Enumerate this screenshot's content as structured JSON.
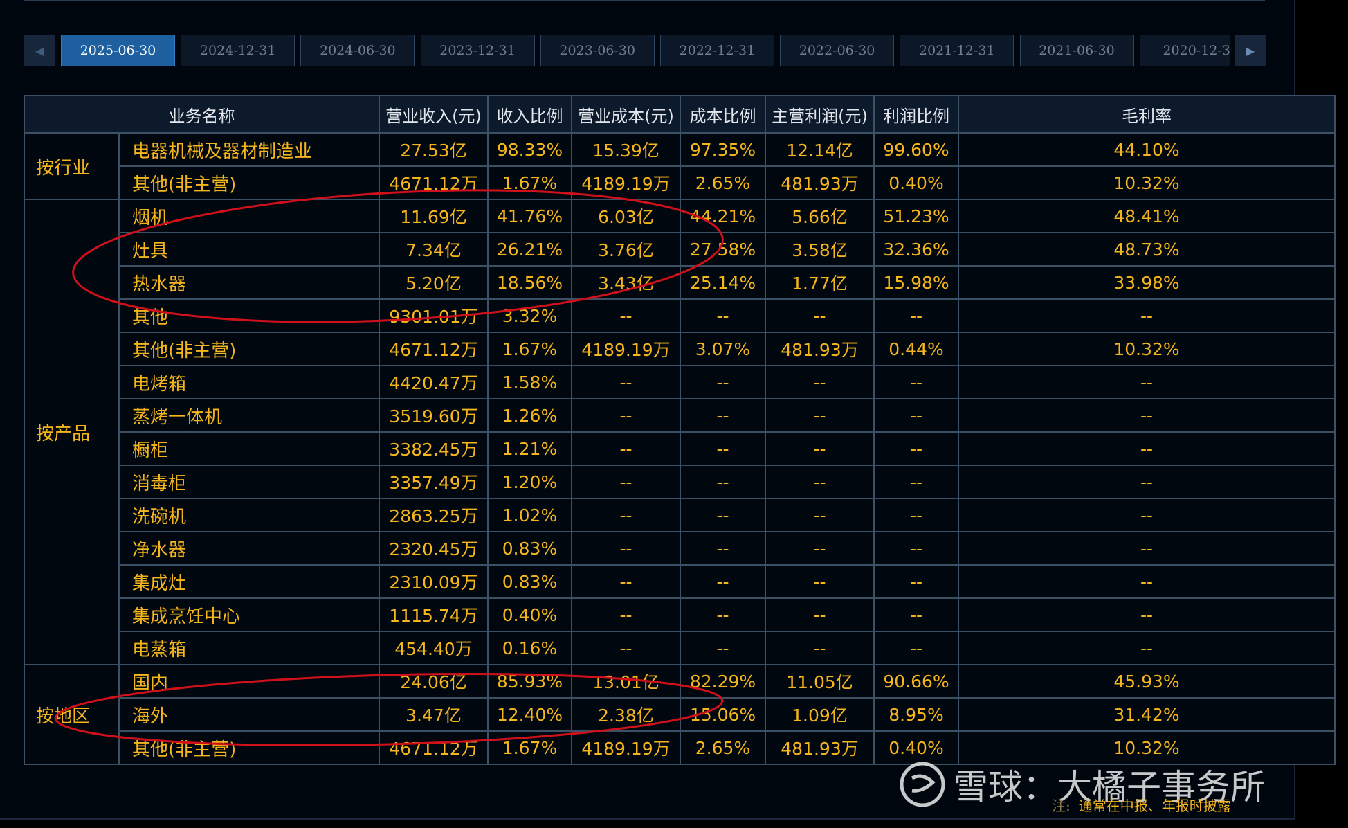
{
  "tabs": [
    "2025-06-30",
    "2024-12-31",
    "2024-06-30",
    "2023-12-31",
    "2023-06-30",
    "2022-12-31",
    "2022-06-30",
    "2021-12-31",
    "2021-06-30",
    "2020-12-3"
  ],
  "active_tab": 0,
  "table": {
    "headers": [
      "业务名称",
      "营业收入(元)",
      "收入比例",
      "营业成本(元)",
      "成本比例",
      "主营利润(元)",
      "利润比例",
      "毛利率"
    ],
    "groups": [
      {
        "label": "按行业",
        "rows": [
          [
            "电器机械及器材制造业",
            "27.53亿",
            "98.33%",
            "15.39亿",
            "97.35%",
            "12.14亿",
            "99.60%",
            "44.10%"
          ],
          [
            "其他(非主营)",
            "4671.12万",
            "1.67%",
            "4189.19万",
            "2.65%",
            "481.93万",
            "0.40%",
            "10.32%"
          ]
        ]
      },
      {
        "label": "按产品",
        "rows": [
          [
            "烟机",
            "11.69亿",
            "41.76%",
            "6.03亿",
            "44.21%",
            "5.66亿",
            "51.23%",
            "48.41%"
          ],
          [
            "灶具",
            "7.34亿",
            "26.21%",
            "3.76亿",
            "27.58%",
            "3.58亿",
            "32.36%",
            "48.73%"
          ],
          [
            "热水器",
            "5.20亿",
            "18.56%",
            "3.43亿",
            "25.14%",
            "1.77亿",
            "15.98%",
            "33.98%"
          ],
          [
            "其他",
            "9301.01万",
            "3.32%",
            "--",
            "--",
            "--",
            "--",
            "--"
          ],
          [
            "其他(非主营)",
            "4671.12万",
            "1.67%",
            "4189.19万",
            "3.07%",
            "481.93万",
            "0.44%",
            "10.32%"
          ],
          [
            "电烤箱",
            "4420.47万",
            "1.58%",
            "--",
            "--",
            "--",
            "--",
            "--"
          ],
          [
            "蒸烤一体机",
            "3519.60万",
            "1.26%",
            "--",
            "--",
            "--",
            "--",
            "--"
          ],
          [
            "橱柜",
            "3382.45万",
            "1.21%",
            "--",
            "--",
            "--",
            "--",
            "--"
          ],
          [
            "消毒柜",
            "3357.49万",
            "1.20%",
            "--",
            "--",
            "--",
            "--",
            "--"
          ],
          [
            "洗碗机",
            "2863.25万",
            "1.02%",
            "--",
            "--",
            "--",
            "--",
            "--"
          ],
          [
            "净水器",
            "2320.45万",
            "0.83%",
            "--",
            "--",
            "--",
            "--",
            "--"
          ],
          [
            "集成灶",
            "2310.09万",
            "0.83%",
            "--",
            "--",
            "--",
            "--",
            "--"
          ],
          [
            "集成烹饪中心",
            "1115.74万",
            "0.40%",
            "--",
            "--",
            "--",
            "--",
            "--"
          ],
          [
            "电蒸箱",
            "454.40万",
            "0.16%",
            "--",
            "--",
            "--",
            "--",
            "--"
          ]
        ]
      },
      {
        "label": "按地区",
        "rows": [
          [
            "国内",
            "24.06亿",
            "85.93%",
            "13.01亿",
            "82.29%",
            "11.05亿",
            "90.66%",
            "45.93%"
          ],
          [
            "海外",
            "3.47亿",
            "12.40%",
            "2.38亿",
            "15.06%",
            "1.09亿",
            "8.95%",
            "31.42%"
          ],
          [
            "其他(非主营)",
            "4671.12万",
            "1.67%",
            "4189.19万",
            "2.65%",
            "481.93万",
            "0.40%",
            "10.32%"
          ]
        ]
      }
    ]
  },
  "watermark": {
    "logo_icon": "xueqiu-logo-icon",
    "text": "雪球：大橘子事务所"
  },
  "note": {
    "label": "注:",
    "text": "通常在中报、年报时披露"
  },
  "colors": {
    "value": "#f5b51c",
    "header_text": "#e2e7ee",
    "active_tab": "#1d5f9f",
    "border": "#3c5066",
    "annotation": "#d0101a"
  }
}
